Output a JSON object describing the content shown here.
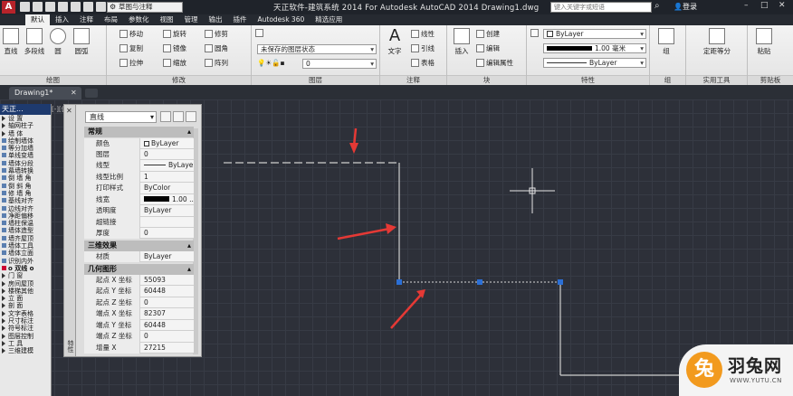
{
  "titlebar": {
    "logo": "A",
    "workspace": "草图与注释",
    "title": "天正软件-建筑系统 2014  For Autodesk AutoCAD 2014   Drawing1.dwg",
    "search_placeholder": "键入关键字或短语",
    "login": "登录"
  },
  "tabs": [
    "默认",
    "插入",
    "注释",
    "布局",
    "参数化",
    "视图",
    "管理",
    "输出",
    "插件",
    "Autodesk 360",
    "精选应用"
  ],
  "ribbon": {
    "draw": {
      "label": "绘图",
      "line": "直线",
      "polyline": "多段线",
      "circle": "圆",
      "arc": "圆弧"
    },
    "modify": {
      "label": "修改",
      "move": "移动",
      "rotate": "旋转",
      "trim": "修剪",
      "copy": "复制",
      "mirror": "镜像",
      "fillet": "圆角",
      "stretch": "拉伸",
      "scale": "缩放",
      "array": "阵列"
    },
    "layers": {
      "label": "图层",
      "state": "未保存的图层状态",
      "current": "0"
    },
    "annotation": {
      "label": "注释",
      "text": "文字",
      "linear": "线性",
      "leader": "引线",
      "table": "表格"
    },
    "block": {
      "label": "块",
      "insert": "插入",
      "create": "创建",
      "edit": "编辑",
      "edit_attr": "编辑属性"
    },
    "properties": {
      "label": "特性",
      "color": "ByLayer",
      "lineweight": "1.00 毫米",
      "linetype": "ByLayer"
    },
    "groups": {
      "label": "组",
      "group": "组"
    },
    "utilities": {
      "label": "实用工具",
      "measure": "定距等分"
    },
    "clipboard": {
      "label": "剪贴板",
      "paste": "粘贴"
    }
  },
  "doc_tab": "Drawing1*",
  "viewport_label": "[-][俯",
  "left_panel": {
    "title": "天正...",
    "items": [
      {
        "label": "设  置",
        "type": "arrow"
      },
      {
        "label": "轴网柱子",
        "type": "arrow"
      },
      {
        "label": "墙  体",
        "type": "arrow"
      },
      {
        "label": "绘制墙体",
        "type": "item"
      },
      {
        "label": "等分加墙",
        "type": "item"
      },
      {
        "label": "单线变墙",
        "type": "item"
      },
      {
        "label": "墙体分段",
        "type": "item"
      },
      {
        "label": "幕墙转换",
        "type": "item"
      },
      {
        "label": "倒 墙 角",
        "type": "item"
      },
      {
        "label": "倒 斜 角",
        "type": "item"
      },
      {
        "label": "修 墙 角",
        "type": "item"
      },
      {
        "label": "基线对齐",
        "type": "item"
      },
      {
        "label": "边线对齐",
        "type": "item"
      },
      {
        "label": "净距偏移",
        "type": "item"
      },
      {
        "label": "墙柱保温",
        "type": "item"
      },
      {
        "label": "墙体造型",
        "type": "item"
      },
      {
        "label": "墙齐屋顶",
        "type": "item"
      },
      {
        "label": "墙体工具",
        "type": "item"
      },
      {
        "label": "墙体立面",
        "type": "item"
      },
      {
        "label": "识别内外",
        "type": "item"
      },
      {
        "label": "o 双线 o",
        "type": "cat"
      },
      {
        "label": "门  窗",
        "type": "arrow"
      },
      {
        "label": "房间屋顶",
        "type": "arrow"
      },
      {
        "label": "楼梯其他",
        "type": "arrow"
      },
      {
        "label": "立  面",
        "type": "arrow"
      },
      {
        "label": "剖  面",
        "type": "arrow"
      },
      {
        "label": "文字表格",
        "type": "arrow"
      },
      {
        "label": "尺寸标注",
        "type": "arrow"
      },
      {
        "label": "符号标注",
        "type": "arrow"
      },
      {
        "label": "图层控制",
        "type": "arrow"
      },
      {
        "label": "工  具",
        "type": "arrow"
      },
      {
        "label": "三维建模",
        "type": "arrow"
      }
    ]
  },
  "properties": {
    "object_type": "直线",
    "strip_label": "特性",
    "sections": [
      {
        "name": "常规",
        "rows": [
          {
            "key": "颜色",
            "value": "ByLayer",
            "swatch": "box"
          },
          {
            "key": "图层",
            "value": "0"
          },
          {
            "key": "线型",
            "value": "ByLayer",
            "swatch": "line"
          },
          {
            "key": "线型比例",
            "value": "1"
          },
          {
            "key": "打印样式",
            "value": "ByColor"
          },
          {
            "key": "线宽",
            "value": "1.00 ...",
            "swatch": "thick"
          },
          {
            "key": "透明度",
            "value": "ByLayer"
          },
          {
            "key": "超链接",
            "value": ""
          },
          {
            "key": "厚度",
            "value": "0"
          }
        ]
      },
      {
        "name": "三维效果",
        "rows": [
          {
            "key": "材质",
            "value": "ByLayer"
          }
        ]
      },
      {
        "name": "几何图形",
        "rows": [
          {
            "key": "起点 X 坐标",
            "value": "55093"
          },
          {
            "key": "起点 Y 坐标",
            "value": "60448"
          },
          {
            "key": "起点 Z 坐标",
            "value": "0"
          },
          {
            "key": "端点 X 坐标",
            "value": "82307"
          },
          {
            "key": "端点 Y 坐标",
            "value": "60448"
          },
          {
            "key": "端点 Z 坐标",
            "value": "0"
          },
          {
            "key": "增量 X",
            "value": "27215"
          }
        ]
      }
    ]
  },
  "watermark": {
    "brand": "羽兔网",
    "url": "WWW.YUTU.CN",
    "mark": "兔"
  },
  "colors": {
    "canvas": "#2d3039",
    "arrow": "#e53935",
    "selected_line": "#d9d9d9",
    "grip": "#2b6fd6",
    "brand": "#f29a1e"
  }
}
